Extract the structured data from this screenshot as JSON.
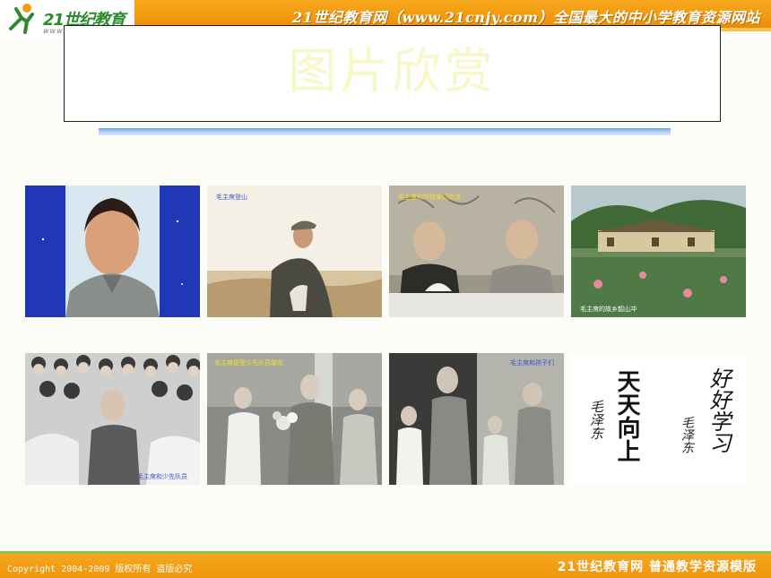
{
  "header": {
    "logo_text": "21世纪教育",
    "logo_sub": "www.",
    "slogan": "21世纪教育网（www.21cnjy.com）全国最大的中小学教育资源网站"
  },
  "title": "图片欣赏",
  "photos": [
    {
      "name": "portrait",
      "caption": ""
    },
    {
      "name": "climbing",
      "caption": "毛主席登山"
    },
    {
      "name": "meeting",
      "caption": "毛主席和外宾亲切交谈"
    },
    {
      "name": "hometown",
      "caption": "毛主席的故乡韶山冲"
    },
    {
      "name": "crowd",
      "caption": "毛主席和少先队员"
    },
    {
      "name": "flowers",
      "caption": "毛主席接受少先队员献花"
    },
    {
      "name": "children",
      "caption": "毛主席和孩子们"
    },
    {
      "name": "calligraphy",
      "caption": ""
    }
  ],
  "calligraphy": {
    "left_text": "天天向上",
    "left_sign": "毛泽东",
    "right_text": "好好学习",
    "right_sign": "毛泽东"
  },
  "footer": {
    "copyright": "Copyright 2004-2009 版权所有 盗版必究",
    "brand": "21世纪教育网   普通教学资源模版"
  }
}
